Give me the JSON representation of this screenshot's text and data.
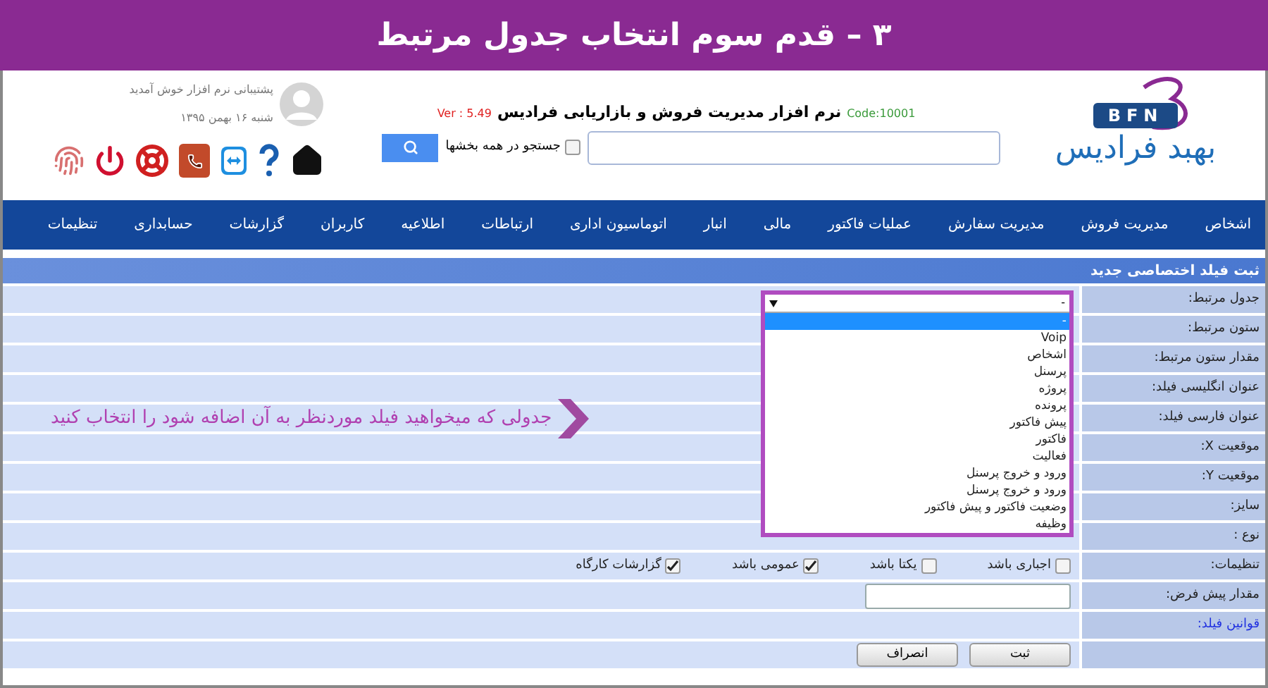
{
  "banner": {
    "title": "۳ – قدم سوم انتخاب جدول مرتبط"
  },
  "header": {
    "logo": {
      "badge": "BFN",
      "wordmark": "بهبد فرادیس"
    },
    "code": "Code:10001",
    "product_title": "نرم افزار مدیریت فروش و بازاریابی فرادیس",
    "version": "Ver : 5.49",
    "search": {
      "all_sections": {
        "label": "جستجو در همه بخشها",
        "checked": false
      }
    },
    "user": {
      "welcome": "پشتیبانی نرم افزار خوش آمدید",
      "date": "شنبه ۱۶ بهمن ۱۳۹۵"
    }
  },
  "nav": [
    "اشخاص",
    "مدیریت فروش",
    "مدیریت سفارش",
    "عملیات فاکتور",
    "مالی",
    "انبار",
    "اتوماسیون اداری",
    "ارتباطات",
    "اطلاعیه",
    "کاربران",
    "گزارشات",
    "حسابداری",
    "تنظیمات"
  ],
  "form": {
    "title": "ثبت فیلد اختصاصی جدید",
    "rows": [
      {
        "label": "جدول مرتبط:",
        "kind": "select"
      },
      {
        "label": "ستون مرتبط:",
        "kind": "blank"
      },
      {
        "label": "مقدار ستون مرتبط:",
        "kind": "blank"
      },
      {
        "label": "عنوان انگلیسی فیلد:",
        "kind": "blank"
      },
      {
        "label": "عنوان فارسی فیلد:",
        "kind": "blank"
      },
      {
        "label": "موقعیت X:",
        "kind": "blank"
      },
      {
        "label": "موقعیت Y:",
        "kind": "blank"
      },
      {
        "label": "سایز:",
        "kind": "blank"
      },
      {
        "label": "نوع :",
        "kind": "blank"
      },
      {
        "label": "تنظیمات:",
        "kind": "checkboxes",
        "options": [
          {
            "label": "اجباری باشد",
            "checked": false
          },
          {
            "label": "یکتا باشد",
            "checked": false
          },
          {
            "label": "عمومی باشد",
            "checked": true
          },
          {
            "label": "گزارشات کارگاه",
            "checked": true
          }
        ]
      },
      {
        "label": "مقدار پیش فرض:",
        "kind": "input"
      },
      {
        "label": "قوانین فیلد:",
        "kind": "link"
      },
      {
        "kind": "buttons",
        "buttons": [
          "ثبت",
          "انصراف"
        ]
      }
    ],
    "dropdown": {
      "value": "-",
      "options": [
        {
          "label": "-",
          "selected": true
        },
        {
          "label": "Voip",
          "selected": false
        },
        {
          "label": "اشخاص",
          "selected": false
        },
        {
          "label": "پرسنل",
          "selected": false
        },
        {
          "label": "پروژه",
          "selected": false
        },
        {
          "label": "پرونده",
          "selected": false
        },
        {
          "label": "پیش فاکتور",
          "selected": false
        },
        {
          "label": "فاکتور",
          "selected": false
        },
        {
          "label": "فعالیت",
          "selected": false
        },
        {
          "label": "ورود و خروج پرسنل",
          "selected": false
        },
        {
          "label": "ورود و خروج پرسنل",
          "selected": false
        },
        {
          "label": "وضعیت فاکتور و پیش فاکتور",
          "selected": false
        },
        {
          "label": "وظیفه",
          "selected": false
        }
      ]
    }
  },
  "annotation": {
    "text": "جدولی که میخواهید فیلد موردنظر به آن اضافه شود را انتخاب کنید"
  }
}
